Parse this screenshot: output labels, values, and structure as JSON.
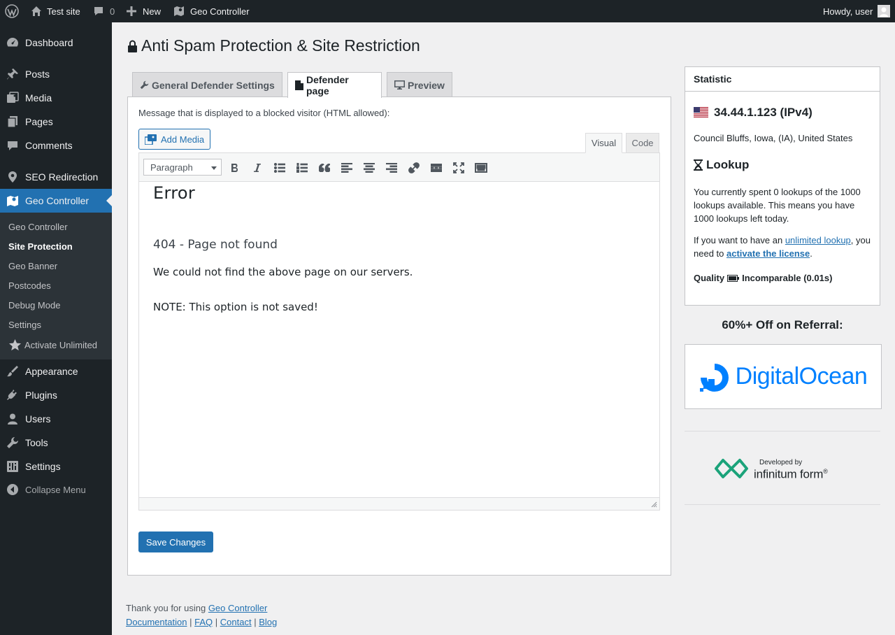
{
  "adminbar": {
    "site_name": "Test site",
    "comments_count": "0",
    "new_label": "New",
    "plugin_label": "Geo Controller",
    "howdy": "Howdy, user"
  },
  "sidebar": {
    "items": [
      {
        "label": "Dashboard",
        "icon": "dashboard-icon"
      },
      {
        "label": "Posts",
        "icon": "pin-icon"
      },
      {
        "label": "Media",
        "icon": "media-icon"
      },
      {
        "label": "Pages",
        "icon": "pages-icon"
      },
      {
        "label": "Comments",
        "icon": "comment-icon"
      },
      {
        "label": "SEO Redirection",
        "icon": "location-icon"
      },
      {
        "label": "Geo Controller",
        "icon": "map-icon"
      },
      {
        "label": "Appearance",
        "icon": "brush-icon"
      },
      {
        "label": "Plugins",
        "icon": "plug-icon"
      },
      {
        "label": "Users",
        "icon": "user-icon"
      },
      {
        "label": "Tools",
        "icon": "wrench-icon"
      },
      {
        "label": "Settings",
        "icon": "sliders-icon"
      }
    ],
    "submenu": [
      "Geo Controller",
      "Site Protection",
      "Geo Banner",
      "Postcodes",
      "Debug Mode",
      "Settings",
      "Activate Unlimited"
    ],
    "collapse_label": "Collapse Menu"
  },
  "page": {
    "title": "Anti Spam Protection & Site Restriction",
    "tabs": [
      "General Defender Settings",
      "Defender page",
      "Preview"
    ],
    "message_label": "Message that is displayed to a blocked visitor (HTML allowed):",
    "add_media": "Add Media",
    "mode_visual": "Visual",
    "mode_code": "Code",
    "format_select": "Paragraph",
    "editor": {
      "heading": "Error",
      "subheading": "404 - Page not found",
      "paragraph1": "We could not find the above page on our servers.",
      "paragraph2": "NOTE: This option is not saved!"
    },
    "save_button": "Save Changes"
  },
  "footer": {
    "thanks": "Thank you for using",
    "plugin_link": "Geo Controller",
    "links": [
      "Documentation",
      "FAQ",
      "Contact",
      "Blog"
    ],
    "separator": "|"
  },
  "statistic": {
    "title": "Statistic",
    "ip": "34.44.1.123 (IPv4)",
    "location": "Council Bluffs, Iowa, (IA), United States",
    "lookup_title": "Lookup",
    "lookup_text": "You currently spent 0 lookups of the 1000 lookups available. This means you have 1000 lookups left today.",
    "license_pre": "If you want to have an",
    "license_link1": "unlimited lookup",
    "license_mid": ", you need to",
    "license_link2": "activate the license",
    "license_post": ".",
    "quality_label": "Quality",
    "quality_value": "Incomparable (0.01s)"
  },
  "referral": {
    "title": "60%+ Off on Referral:",
    "brand": "DigitalOcean",
    "dev_small": "Developed by",
    "dev_big": "infinitum form",
    "dev_mark": "®"
  },
  "colors": {
    "admin_dark": "#1d2327",
    "accent": "#2271b1",
    "digitalocean": "#0080ff",
    "infinitum": "#1ba37a"
  }
}
